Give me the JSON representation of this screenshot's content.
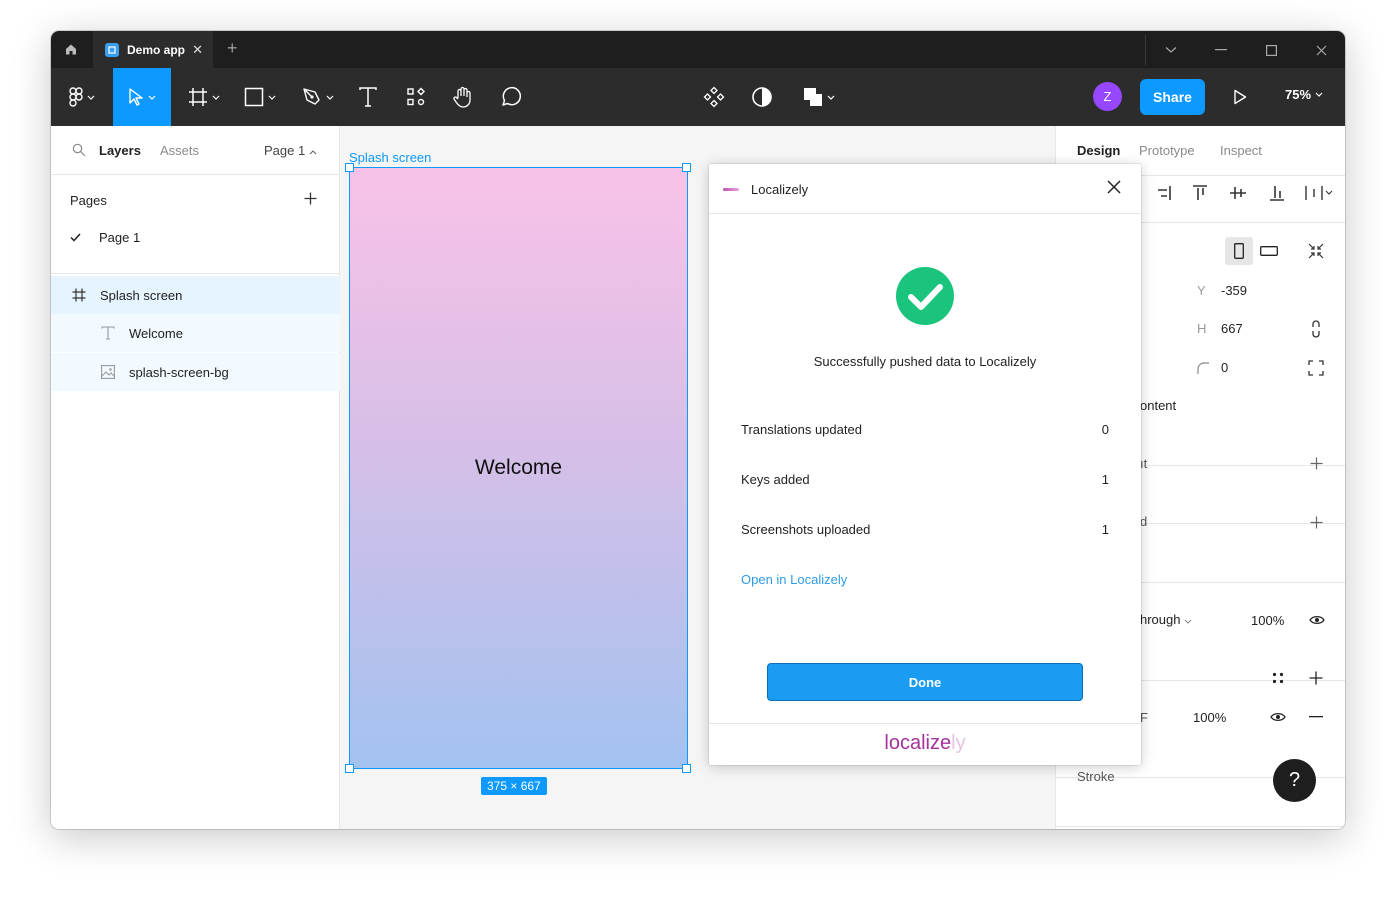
{
  "titlebar": {
    "tab_title": "Demo app",
    "tab_close": "✕",
    "new_tab": "+"
  },
  "toolbar": {
    "share_label": "Share",
    "zoom": "75%",
    "avatar_initial": "Z"
  },
  "left_panel": {
    "tabs": [
      "Layers",
      "Assets"
    ],
    "page_selector": "Page 1",
    "pages_heading": "Pages",
    "pages": [
      {
        "label": "Page 1",
        "selected": true
      }
    ],
    "layers": [
      {
        "label": "Splash screen",
        "type": "frame"
      },
      {
        "label": "Welcome",
        "type": "text"
      },
      {
        "label": "splash-screen-bg",
        "type": "image"
      }
    ]
  },
  "canvas": {
    "frame_label": "Splash screen",
    "frame_text": "Welcome",
    "dimensions": "375 × 667"
  },
  "right_panel": {
    "tabs": [
      "Design",
      "Prototype",
      "Inspect"
    ],
    "y_label": "Y",
    "y_value": "-359",
    "h_label": "H",
    "h_value": "667",
    "radius_value": "0",
    "clip_fragment": "ontent",
    "section_frag_1": "ıt",
    "section_frag_2": "d",
    "blend_fragment": "hrough",
    "layer_opacity": "100%",
    "fill_fragment": "F",
    "fill_opacity": "100%",
    "stroke_label": "Stroke",
    "help": "?"
  },
  "plugin": {
    "title": "Localizely",
    "message": "Successfully pushed data to Localizely",
    "stats": [
      {
        "label": "Translations updated",
        "value": "0"
      },
      {
        "label": "Keys added",
        "value": "1"
      },
      {
        "label": "Screenshots uploaded",
        "value": "1"
      }
    ],
    "link": "Open in Localizely",
    "done": "Done",
    "footer_brand": "localize",
    "footer_brand_fade": "ly"
  },
  "colors": {
    "accent": "#0d99ff",
    "success": "#1bc47d",
    "brand": "#a3329a"
  }
}
